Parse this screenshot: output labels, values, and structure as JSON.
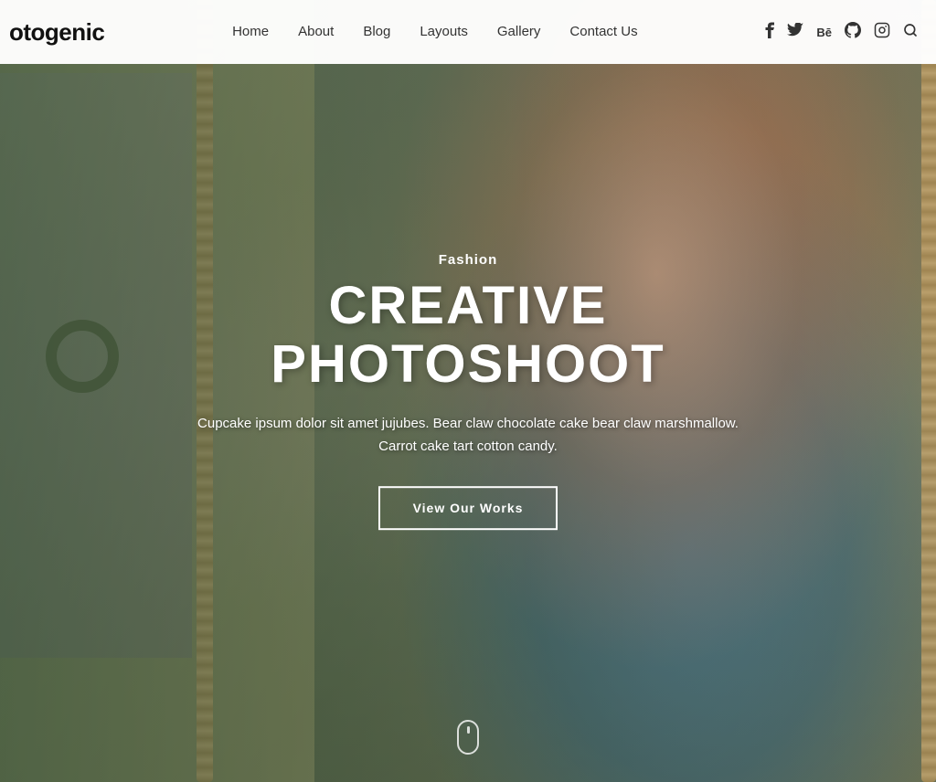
{
  "brand": {
    "logo_text": "otogenic",
    "logo_prefix": ""
  },
  "navbar": {
    "links": [
      {
        "label": "Home",
        "id": "home"
      },
      {
        "label": "About",
        "id": "about"
      },
      {
        "label": "Blog",
        "id": "blog"
      },
      {
        "label": "Layouts",
        "id": "layouts"
      },
      {
        "label": "Gallery",
        "id": "gallery"
      },
      {
        "label": "Contact Us",
        "id": "contact"
      }
    ],
    "social_icons": [
      {
        "name": "facebook-icon",
        "symbol": "f"
      },
      {
        "name": "twitter-icon",
        "symbol": "𝕏"
      },
      {
        "name": "behance-icon",
        "symbol": "Bē"
      },
      {
        "name": "github-icon",
        "symbol": "⌥"
      },
      {
        "name": "instagram-icon",
        "symbol": "◻"
      },
      {
        "name": "search-icon",
        "symbol": "🔍"
      }
    ]
  },
  "hero": {
    "category": "Fashion",
    "title": "CREATIVE PHOTOSHOOT",
    "description": "Cupcake ipsum dolor sit amet jujubes. Bear claw chocolate cake bear claw marshmallow. Carrot cake tart cotton candy.",
    "cta_label": "View Our Works"
  }
}
